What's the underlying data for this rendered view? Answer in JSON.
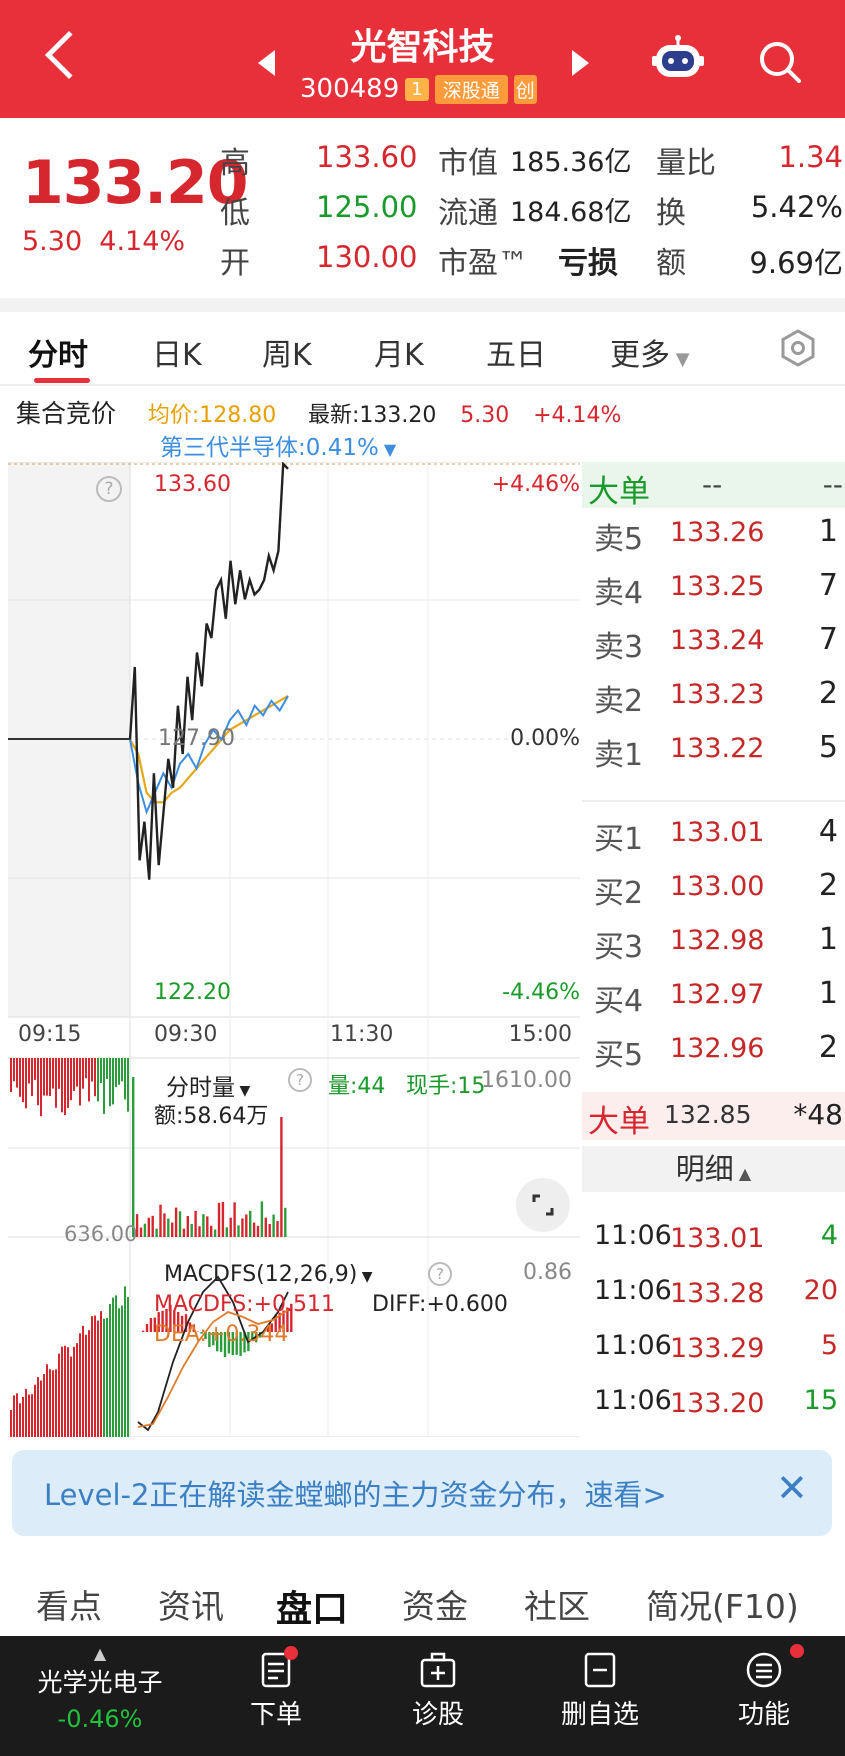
{
  "header": {
    "title": "光智科技",
    "code": "300489",
    "level_tag": "1",
    "market_tag": "深股通",
    "extra_tag": "创"
  },
  "quote": {
    "price": "133.20",
    "change_abs": "5.30",
    "change_pct": "4.14%",
    "labels": {
      "high": "高",
      "low": "低",
      "open": "开",
      "mcap": "市值",
      "float": "流通",
      "pe": "市盈™",
      "vol_ratio": "量比",
      "turnover": "换",
      "amount": "额"
    },
    "high": "133.60",
    "low": "125.00",
    "open": "130.00",
    "mcap": "185.36亿",
    "float": "184.68亿",
    "pe": "亏损",
    "vol_ratio": "1.34",
    "turnover": "5.42%",
    "amount": "9.69亿"
  },
  "tabs": [
    "分时",
    "日K",
    "周K",
    "月K",
    "五日",
    "更多"
  ],
  "info": {
    "auction": "集合竞价",
    "avg": "均价:128.80",
    "latest": "最新:133.20",
    "chg": "5.30",
    "pct": "+4.14%",
    "sector": "第三代半导体:0.41%"
  },
  "chart": {
    "high_label": "133.60",
    "high_pct": "+4.46%",
    "mid_label": "127.90",
    "mid_pct": "0.00%",
    "low_label": "122.20",
    "low_pct": "-4.46%",
    "times": [
      "09:15",
      "09:30",
      "11:30",
      "15:00"
    ],
    "vol_title": "分时量",
    "vol_now": "量:44",
    "vol_hand": "现手:15",
    "vol_max": "1610.00",
    "vol_amount": "额:58.64万",
    "auction_vol": "636.00",
    "macd_title": "MACDFS(12,26,9)",
    "macd_val": "MACDFS:+0.511",
    "diff": "DIFF:+0.600",
    "dea": "DEA:+0.344",
    "macd_max": "0.86",
    "price_series": [
      127.9,
      129.4,
      125.4,
      126.2,
      125.0,
      127.2,
      125.3,
      126.4,
      127.5,
      126.9,
      128.6,
      127.6,
      129.2,
      128.3,
      129.7,
      129.0,
      130.3,
      130.0,
      131.0,
      131.2,
      130.4,
      131.6,
      130.7,
      131.4,
      130.8,
      131.2,
      130.9,
      131.0,
      131.2,
      131.7,
      131.4,
      131.8,
      133.6,
      133.5
    ],
    "avg_series": [
      127.9,
      127.6,
      126.8,
      126.6,
      126.6,
      126.8,
      126.9,
      127.1,
      127.3,
      127.5,
      127.7,
      127.9,
      128.1,
      128.2,
      128.3,
      128.4,
      128.5,
      128.6,
      128.7,
      128.8
    ],
    "sector_series": [
      127.9,
      127.0,
      126.4,
      126.8,
      127.2,
      126.9,
      127.4,
      127.6,
      127.3,
      127.8,
      128.1,
      127.9,
      128.3,
      128.5,
      128.2,
      128.6,
      128.4,
      128.7,
      128.5,
      128.8
    ]
  },
  "orderbook": {
    "big_label": "大单",
    "big_a": "--",
    "big_b": "--",
    "asks": [
      {
        "name": "卖5",
        "price": "133.26",
        "vol": "1"
      },
      {
        "name": "卖4",
        "price": "133.25",
        "vol": "7"
      },
      {
        "name": "卖3",
        "price": "133.24",
        "vol": "7"
      },
      {
        "name": "卖2",
        "price": "133.23",
        "vol": "2"
      },
      {
        "name": "卖1",
        "price": "133.22",
        "vol": "5"
      }
    ],
    "bids": [
      {
        "name": "买1",
        "price": "133.01",
        "vol": "4"
      },
      {
        "name": "买2",
        "price": "133.00",
        "vol": "2"
      },
      {
        "name": "买3",
        "price": "132.98",
        "vol": "1"
      },
      {
        "name": "买4",
        "price": "132.97",
        "vol": "1"
      },
      {
        "name": "买5",
        "price": "132.96",
        "vol": "2"
      }
    ],
    "big2_label": "大单",
    "big2_price": "132.85",
    "big2_vol": "*48",
    "detail_label": "明细",
    "trades": [
      {
        "time": "11:06",
        "price": "133.01",
        "vol": "4",
        "dir": "up"
      },
      {
        "time": "11:06",
        "price": "133.28",
        "vol": "20",
        "dir": "down"
      },
      {
        "time": "11:06",
        "price": "133.29",
        "vol": "5",
        "dir": "down"
      },
      {
        "time": "11:06",
        "price": "133.20",
        "vol": "15",
        "dir": "up"
      }
    ]
  },
  "banner": {
    "text": "Level-2正在解读金螳螂的主力资金分布，速看>",
    "close": "✕"
  },
  "bottom_tabs": [
    "看点",
    "资讯",
    "盘口",
    "资金",
    "社区",
    "简况(F10)"
  ],
  "bottombar": {
    "sector_name": "光学光电子",
    "sector_pct": "-0.46%",
    "items": [
      "下单",
      "诊股",
      "删自选",
      "功能"
    ]
  },
  "colors": {
    "brand": "#e8303a",
    "up": "#d6262e",
    "down": "#1a9a2a"
  }
}
